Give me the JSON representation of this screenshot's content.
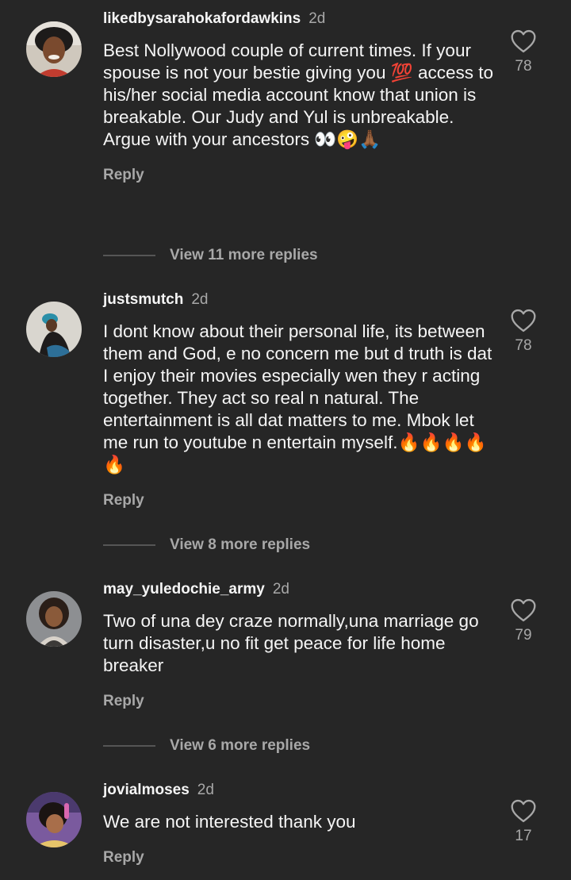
{
  "comments": [
    {
      "username": "likedbysarahokafordawkins",
      "time": "2d",
      "text": "Best Nollywood couple of current times. If your spouse is not your bestie giving you 💯 access to his/her social media account know that union is breakable. Our Judy and Yul is unbreakable. Argue with your ancestors 👀🤪🙏🏾",
      "reply_label": "Reply",
      "likes": "78",
      "view_replies": "View 11 more replies"
    },
    {
      "username": "justsmutch",
      "time": "2d",
      "text": "I dont know about their personal life, its between them and God, e no concern me but d truth is dat I enjoy their movies especially wen they r acting together. They act so real n natural. The entertainment is all dat matters to me. Mbok let me run to youtube n entertain myself.🔥🔥🔥🔥🔥",
      "reply_label": "Reply",
      "likes": "78",
      "view_replies": "View 8 more replies"
    },
    {
      "username": "may_yuledochie_army",
      "time": "2d",
      "text": "Two of una dey craze normally,una marriage go turn disaster,u no fit get peace for life home breaker",
      "reply_label": "Reply",
      "likes": "79",
      "view_replies": "View 6 more replies"
    },
    {
      "username": "jovialmoses",
      "time": "2d",
      "text": "We are not interested thank you",
      "reply_label": "Reply",
      "likes": "17"
    }
  ],
  "colors": {
    "background": "#262626",
    "primary_text": "#f5f5f5",
    "secondary_text": "#a8a8a8"
  },
  "icons": {
    "like": "heart-outline-icon"
  }
}
